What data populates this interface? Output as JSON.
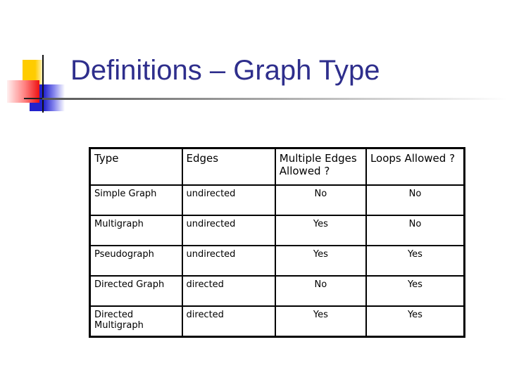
{
  "slide": {
    "title": "Definitions – Graph Type"
  },
  "table": {
    "headers": [
      "Type",
      "Edges",
      "Multiple Edges Allowed ?",
      "Loops Allowed ?"
    ],
    "rows": [
      [
        "Simple Graph",
        "undirected",
        "No",
        "No"
      ],
      [
        "Multigraph",
        "undirected",
        "Yes",
        "No"
      ],
      [
        "Pseudograph",
        "undirected",
        "Yes",
        "Yes"
      ],
      [
        "Directed Graph",
        "directed",
        "No",
        "Yes"
      ],
      [
        "Directed Multigraph",
        "directed",
        "Yes",
        "Yes"
      ]
    ]
  },
  "colors": {
    "title": "#2e2e8c",
    "logo_yellow": "#ffcc00",
    "logo_blue": "#2222cc",
    "logo_red": "#ee1111"
  }
}
